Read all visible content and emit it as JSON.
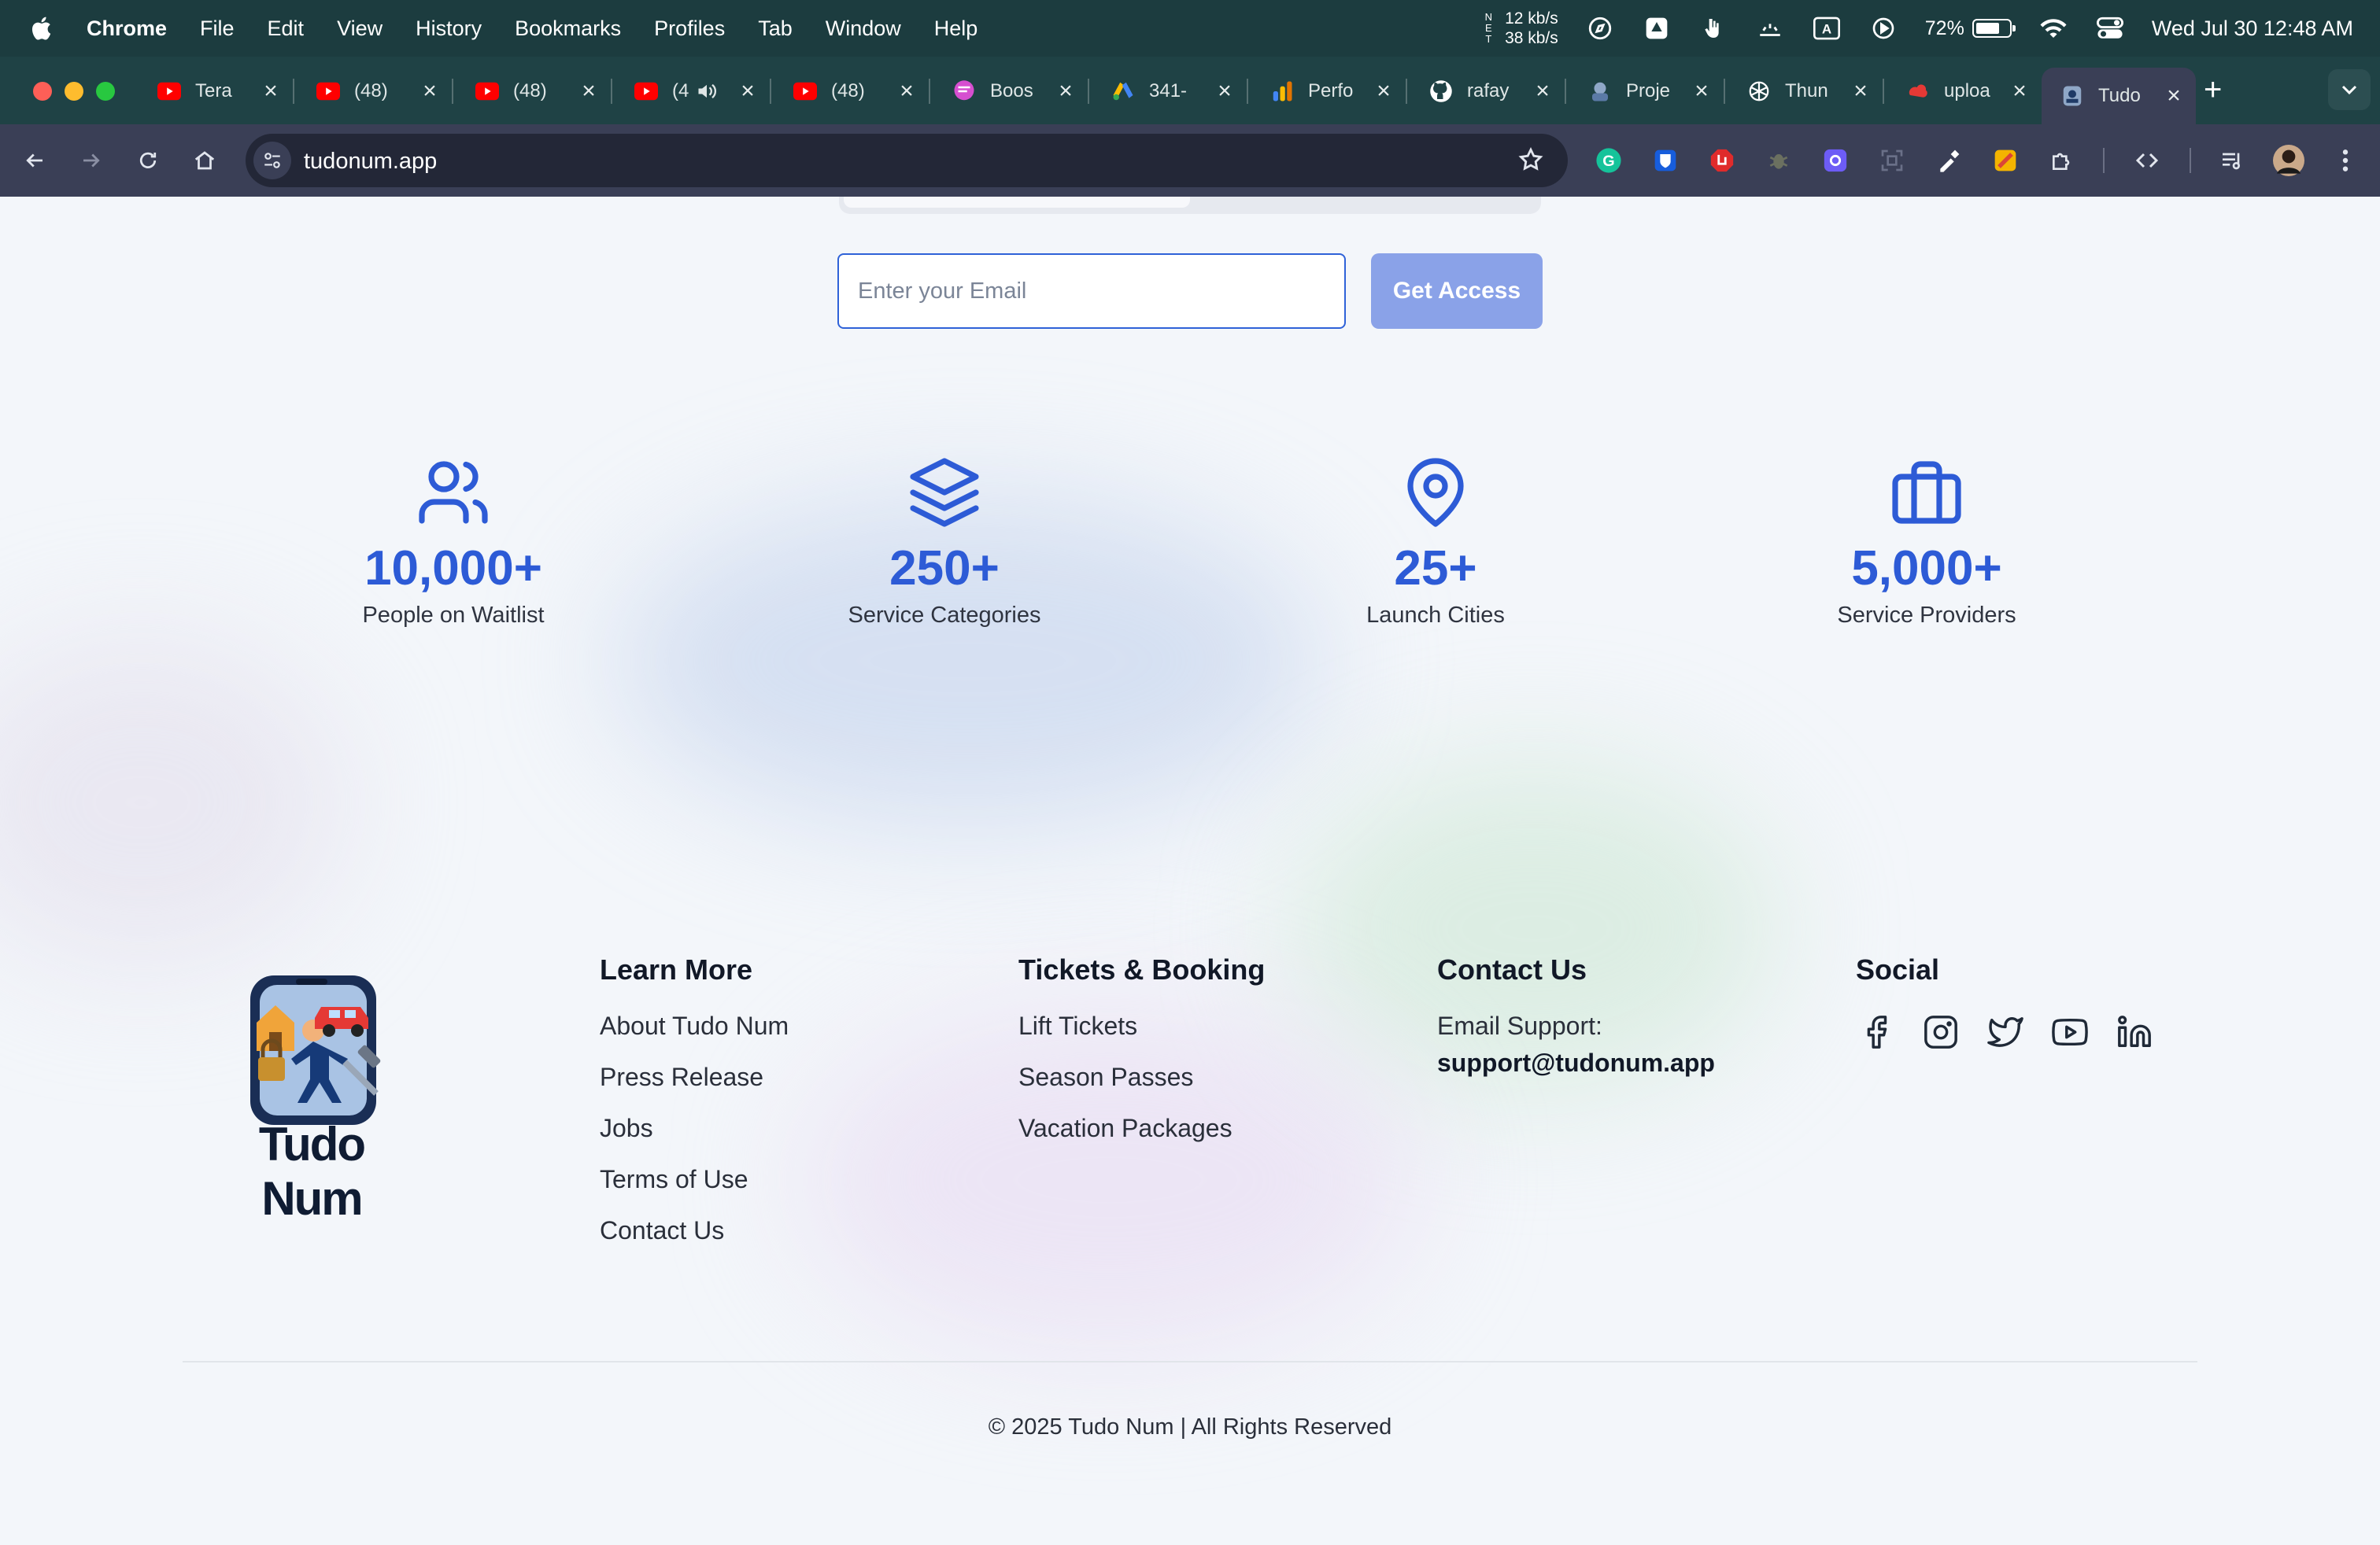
{
  "menubar": {
    "app": "Chrome",
    "items": [
      "File",
      "Edit",
      "View",
      "History",
      "Bookmarks",
      "Profiles",
      "Tab",
      "Window",
      "Help"
    ],
    "net_label": "N E T",
    "net_up": "12 kb/s",
    "net_down": "38 kb/s",
    "battery_percent": "72%",
    "battery_level": 0.72,
    "clock": "Wed Jul 30  12:48 AM"
  },
  "tabs": [
    {
      "title": "Tera",
      "icon": "youtube-icon"
    },
    {
      "title": "(48)",
      "icon": "youtube-icon"
    },
    {
      "title": "(48)",
      "icon": "youtube-icon"
    },
    {
      "title": "(4",
      "icon": "youtube-icon",
      "audio": true
    },
    {
      "title": "(48)",
      "icon": "youtube-icon"
    },
    {
      "title": "Boos",
      "icon": "chat-bubble-icon"
    },
    {
      "title": "341-",
      "icon": "google-ads-icon"
    },
    {
      "title": "Perfo",
      "icon": "analytics-icon"
    },
    {
      "title": "rafay",
      "icon": "github-icon"
    },
    {
      "title": "Proje",
      "icon": "project-icon"
    },
    {
      "title": "Thun",
      "icon": "openai-icon"
    },
    {
      "title": "uploa",
      "icon": "upload-icon"
    },
    {
      "title": "Tudo",
      "icon": "tudonum-icon",
      "active": true
    }
  ],
  "toolbar": {
    "url": "tudonum.app"
  },
  "signup": {
    "email_placeholder": "Enter your Email",
    "button_label": "Get Access",
    "button_color": "#8aa2e8"
  },
  "stats": [
    {
      "value": "10,000+",
      "label": "People on Waitlist",
      "icon": "users-icon"
    },
    {
      "value": "250+",
      "label": "Service Categories",
      "icon": "layers-icon"
    },
    {
      "value": "25+",
      "label": "Launch Cities",
      "icon": "map-pin-icon"
    },
    {
      "value": "5,000+",
      "label": "Service Providers",
      "icon": "briefcase-icon"
    }
  ],
  "brand": {
    "name": "Tudo Num",
    "accent": "#2d5bd6"
  },
  "footer": {
    "learn_more": {
      "heading": "Learn More",
      "links": [
        "About Tudo Num",
        "Press Release",
        "Jobs",
        "Terms of Use",
        "Contact Us"
      ]
    },
    "tickets": {
      "heading": "Tickets & Booking",
      "links": [
        "Lift Tickets",
        "Season Passes",
        "Vacation Packages"
      ]
    },
    "contact": {
      "heading": "Contact Us",
      "email_label": "Email Support:",
      "email": "support@tudonum.app"
    },
    "social": {
      "heading": "Social",
      "icons": [
        "facebook-icon",
        "instagram-icon",
        "twitter-icon",
        "youtube-icon",
        "linkedin-icon"
      ]
    },
    "copyright": "© 2025 Tudo Num | All Rights Reserved"
  }
}
